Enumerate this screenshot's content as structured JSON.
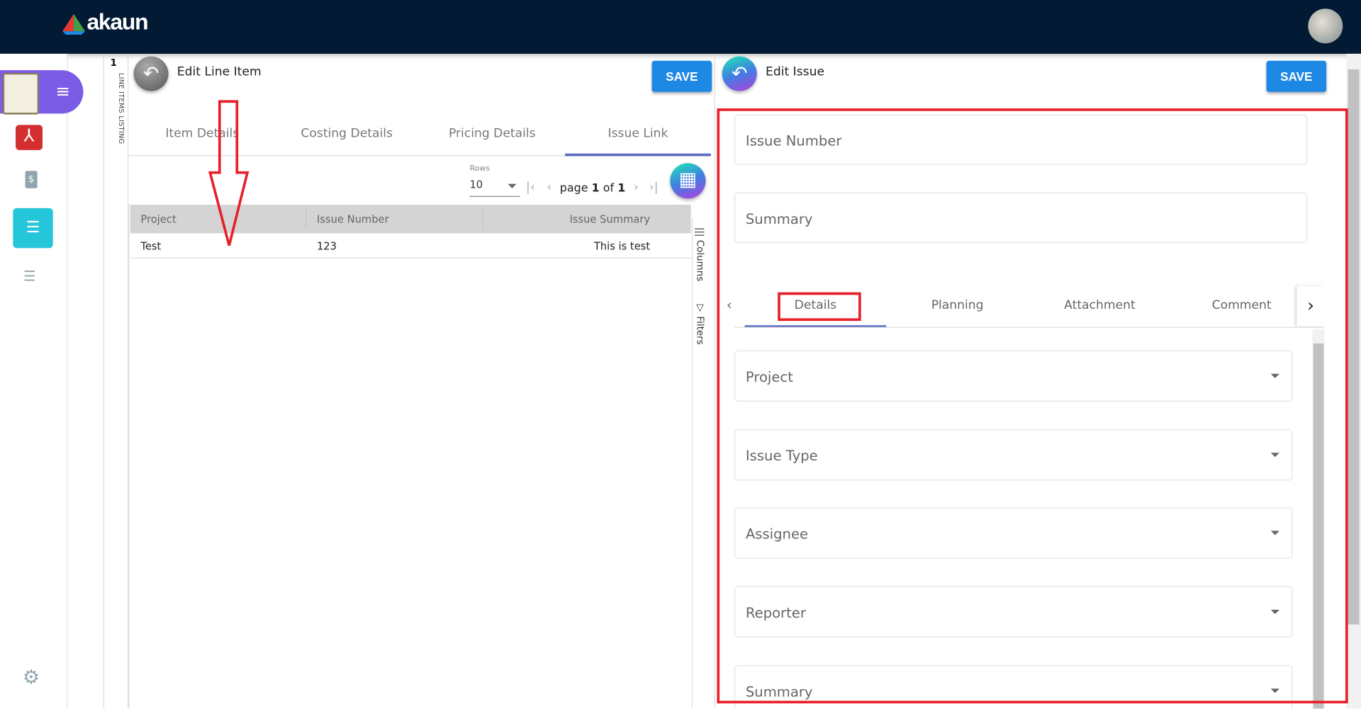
{
  "app": {
    "logo": "akaun"
  },
  "strip": {
    "count": "1",
    "label": "LINE ITEMS LISTING"
  },
  "left": {
    "title": "Edit Line Item",
    "save": "SAVE",
    "tabs": [
      "Item Details",
      "Costing Details",
      "Pricing Details",
      "Issue Link"
    ],
    "active_tab": "Issue Link",
    "pager": {
      "rows_label": "Rows",
      "rows_value": "10",
      "page_word": "page",
      "page": "1",
      "of_word": "of",
      "total": "1"
    },
    "columns": [
      "Project",
      "Issue Number",
      "Issue Summary"
    ],
    "rows": [
      {
        "project": "Test",
        "issue_number": "123",
        "issue_summary": "This is test"
      }
    ],
    "side_tabs": {
      "columns": "Columns",
      "filters": "Filters"
    }
  },
  "right": {
    "title": "Edit Issue",
    "save": "SAVE",
    "fields": {
      "issue_number": "Issue Number",
      "summary": "Summary"
    },
    "tabs": [
      "Details",
      "Planning",
      "Attachment",
      "Comment"
    ],
    "active_tab": "Details",
    "selects": [
      "Project",
      "Issue Type",
      "Assignee",
      "Reporter",
      "Summary"
    ]
  },
  "colors": {
    "topbar": "#021a33",
    "save": "#1e88e5",
    "annotation": "#e8202a",
    "active_tab": "#5c6bc0"
  }
}
